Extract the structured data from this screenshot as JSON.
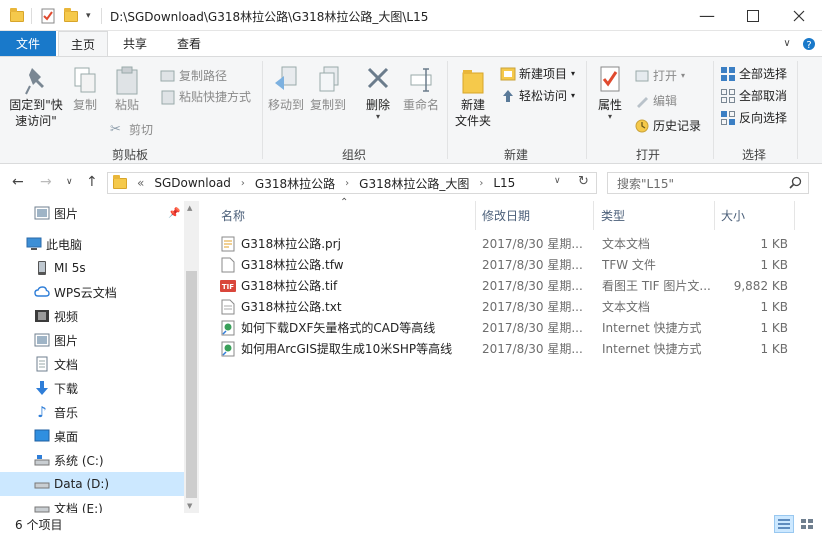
{
  "window": {
    "title": "D:\\SGDownload\\G318林拉公路\\G318林拉公路_大图\\L15"
  },
  "tabs": {
    "file": "文件",
    "home": "主页",
    "share": "共享",
    "view": "查看"
  },
  "ribbon": {
    "clipboard": {
      "label": "剪贴板",
      "pin": "固定到\"快\n速访问\"",
      "copy": "复制",
      "paste": "粘贴",
      "copy_path": "复制路径",
      "paste_shortcut": "粘贴快捷方式",
      "cut": "剪切"
    },
    "organize": {
      "label": "组织",
      "move_to": "移动到",
      "copy_to": "复制到",
      "delete": "删除",
      "rename": "重命名"
    },
    "new": {
      "label": "新建",
      "new_folder": "新建\n文件夹",
      "new_item": "新建项目",
      "easy_access": "轻松访问"
    },
    "open": {
      "label": "打开",
      "properties": "属性",
      "open": "打开",
      "edit": "编辑",
      "history": "历史记录"
    },
    "select": {
      "label": "选择",
      "select_all": "全部选择",
      "select_none": "全部取消",
      "invert": "反向选择"
    }
  },
  "address": {
    "overflow": "«",
    "crumbs": [
      "SGDownload",
      "G318林拉公路",
      "G318林拉公路_大图",
      "L15"
    ],
    "search_placeholder": "搜索\"L15\""
  },
  "nav": {
    "items": [
      {
        "label": "图片",
        "icon": "pictures-icon",
        "pinned": true
      },
      {
        "label": "此电脑",
        "icon": "computer-icon"
      },
      {
        "label": "MI 5s",
        "icon": "phone-icon"
      },
      {
        "label": "WPS云文档",
        "icon": "cloud-icon"
      },
      {
        "label": "视频",
        "icon": "video-icon"
      },
      {
        "label": "图片",
        "icon": "pictures-icon"
      },
      {
        "label": "文档",
        "icon": "documents-icon"
      },
      {
        "label": "下载",
        "icon": "download-icon"
      },
      {
        "label": "音乐",
        "icon": "music-icon"
      },
      {
        "label": "桌面",
        "icon": "desktop-icon"
      },
      {
        "label": "系统 (C:)",
        "icon": "system-drive-icon"
      },
      {
        "label": "Data (D:)",
        "icon": "drive-icon",
        "selected": true
      },
      {
        "label": "文档 (E:)",
        "icon": "drive-icon"
      }
    ]
  },
  "columns": {
    "name": "名称",
    "date": "修改日期",
    "type": "类型",
    "size": "大小"
  },
  "files": [
    {
      "name": "G318林拉公路.prj",
      "date": "2017/8/30 星期...",
      "type": "文本文档",
      "size": "1 KB",
      "icon": "text-file-icon"
    },
    {
      "name": "G318林拉公路.tfw",
      "date": "2017/8/30 星期...",
      "type": "TFW 文件",
      "size": "1 KB",
      "icon": "generic-file-icon"
    },
    {
      "name": "G318林拉公路.tif",
      "date": "2017/8/30 星期...",
      "type": "看图王 TIF 图片文...",
      "size": "9,882 KB",
      "icon": "tif-image-icon"
    },
    {
      "name": "G318林拉公路.txt",
      "date": "2017/8/30 星期...",
      "type": "文本文档",
      "size": "1 KB",
      "icon": "text-file-icon"
    },
    {
      "name": "如何下载DXF矢量格式的CAD等高线",
      "date": "2017/8/30 星期...",
      "type": "Internet 快捷方式",
      "size": "1 KB",
      "icon": "internet-shortcut-icon"
    },
    {
      "name": "如何用ArcGIS提取生成10米SHP等高线",
      "date": "2017/8/30 星期...",
      "type": "Internet 快捷方式",
      "size": "1 KB",
      "icon": "internet-shortcut-icon"
    }
  ],
  "status": {
    "count": "6 个项目"
  },
  "colors": {
    "accent": "#1979ca",
    "selection": "#cce8ff"
  }
}
